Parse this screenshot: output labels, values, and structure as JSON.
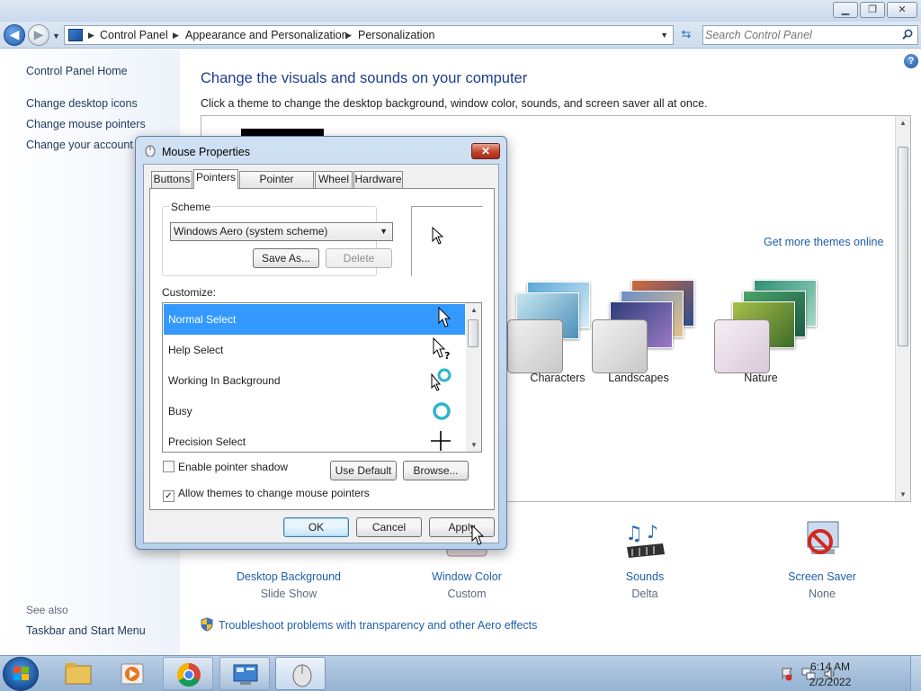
{
  "explorer": {
    "breadcrumb": [
      "Control Panel",
      "Appearance and Personalization",
      "Personalization"
    ],
    "search_placeholder": "Search Control Panel"
  },
  "left_pane": {
    "home": "Control Panel Home",
    "links": [
      "Change desktop icons",
      "Change mouse pointers",
      "Change your account picture"
    ],
    "see_also_label": "See also",
    "see_also_links": [
      "Taskbar and Start Menu"
    ]
  },
  "main": {
    "title": "Change the visuals and sounds on your computer",
    "subtitle": "Click a theme to change the desktop background, window color, sounds, and screen saver all at once.",
    "more_themes": "Get more themes online",
    "themes": [
      {
        "name": "Characters"
      },
      {
        "name": "Landscapes"
      },
      {
        "name": "Nature"
      }
    ],
    "bottom_items": [
      {
        "label": "Desktop Background",
        "value": "Slide Show"
      },
      {
        "label": "Window Color",
        "value": "Custom"
      },
      {
        "label": "Sounds",
        "value": "Delta"
      },
      {
        "label": "Screen Saver",
        "value": "None"
      }
    ],
    "troubleshoot": "Troubleshoot problems with transparency and other Aero effects"
  },
  "dialog": {
    "title": "Mouse Properties",
    "close_label": "✕",
    "tabs": [
      "Buttons",
      "Pointers",
      "Pointer Options",
      "Wheel",
      "Hardware"
    ],
    "selected_tab": "Pointers",
    "scheme_label": "Scheme",
    "scheme_value": "Windows Aero (system scheme)",
    "save_as": "Save As...",
    "delete": "Delete",
    "customize_label": "Customize:",
    "pointers": [
      "Normal Select",
      "Help Select",
      "Working In Background",
      "Busy",
      "Precision Select"
    ],
    "selected_pointer": "Normal Select",
    "enable_shadow": {
      "label": "Enable pointer shadow",
      "checked": false
    },
    "allow_themes": {
      "label": "Allow themes to change mouse pointers",
      "checked": true
    },
    "use_default": "Use Default",
    "browse": "Browse...",
    "ok": "OK",
    "cancel": "Cancel",
    "apply": "Apply"
  },
  "taskbar": {
    "time": "6:14 AM",
    "date": "2/2/2022"
  },
  "colors": {
    "accent": "#1f5fa8",
    "heading": "#1e3e8c",
    "selection": "#3399ff"
  }
}
